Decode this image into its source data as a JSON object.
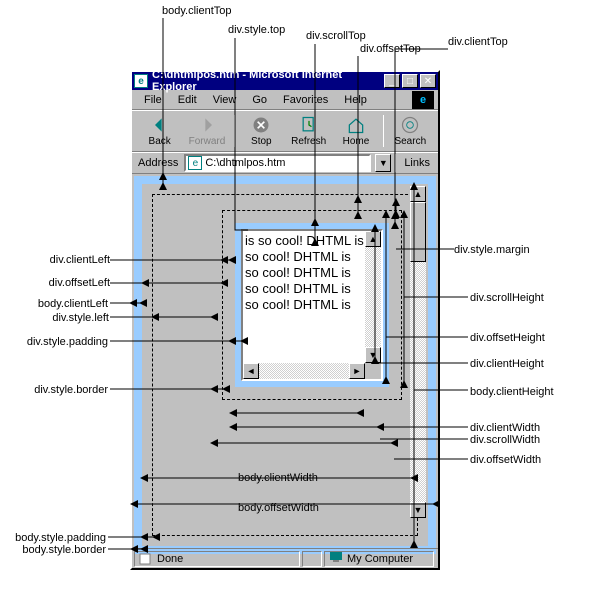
{
  "window": {
    "title": "C:\\dhtmlpos.htm - Microsoft Internet Explorer",
    "icon_glyph": "e"
  },
  "menu": [
    "File",
    "Edit",
    "View",
    "Go",
    "Favorites",
    "Help"
  ],
  "menu_logo_glyph": "e",
  "toolbar": [
    {
      "name": "back",
      "label": "Back"
    },
    {
      "name": "forward",
      "label": "Forward"
    },
    {
      "name": "stop",
      "label": "Stop"
    },
    {
      "name": "refresh",
      "label": "Refresh"
    },
    {
      "name": "home",
      "label": "Home"
    },
    {
      "name": "search",
      "label": "Search"
    }
  ],
  "address": {
    "label": "Address",
    "value": "C:\\dhtmlpos.htm",
    "links_label": "Links"
  },
  "status": {
    "done": "Done",
    "zone": "My Computer"
  },
  "doc_text": "is so cool! DHTML is so cool! DHTML is so cool! DHTML is so cool! DHTML is so cool! DHTML is",
  "callouts": {
    "top": [
      {
        "key": "body.clientTop",
        "label": "body.clientTop"
      },
      {
        "key": "div.style.top",
        "label": "div.style.top"
      },
      {
        "key": "div.scrollTop",
        "label": "div.scrollTop"
      },
      {
        "key": "div.offsetTop",
        "label": "div.offsetTop"
      },
      {
        "key": "div.clientTop",
        "label": "div.clientTop"
      }
    ],
    "left": [
      {
        "key": "div.clientLeft",
        "label": "div.clientLeft"
      },
      {
        "key": "div.offsetLeft",
        "label": "div.offsetLeft"
      },
      {
        "key": "body.clientLeft",
        "label": "body.clientLeft"
      },
      {
        "key": "div.style.left",
        "label": "div.style.left"
      },
      {
        "key": "div.style.padding",
        "label": "div.style.padding"
      },
      {
        "key": "div.style.border",
        "label": "div.style.border"
      },
      {
        "key": "body.style.padding",
        "label": "body.style.padding"
      },
      {
        "key": "body.style.border",
        "label": "body.style.border"
      }
    ],
    "right": [
      {
        "key": "div.style.margin",
        "label": "div.style.margin"
      },
      {
        "key": "div.scrollHeight",
        "label": "div.scrollHeight"
      },
      {
        "key": "div.offsetHeight",
        "label": "div.offsetHeight"
      },
      {
        "key": "div.clientHeight",
        "label": "div.clientHeight"
      },
      {
        "key": "body.clientHeight",
        "label": "body.clientHeight"
      },
      {
        "key": "div.clientWidth",
        "label": "div.clientWidth"
      },
      {
        "key": "div.scrollWidth",
        "label": "div.scrollWidth"
      },
      {
        "key": "div.offsetWidth",
        "label": "div.offsetWidth"
      }
    ],
    "bottom": [
      {
        "key": "body.clientWidth",
        "label": "body.clientWidth"
      },
      {
        "key": "body.offsetWidth",
        "label": "body.offsetWidth"
      }
    ]
  },
  "colors": {
    "border_blue": "#99ccff",
    "win_gray": "#c0c0c0",
    "title_blue": "#000080"
  }
}
